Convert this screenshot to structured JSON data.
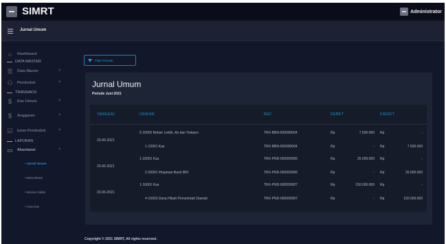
{
  "app": {
    "brand": "SIMRT",
    "user": "Administrator",
    "page_title": "Jurnal Umum"
  },
  "sidebar": {
    "items": [
      {
        "type": "link",
        "icon": "home-icon",
        "label": "Dashboard"
      },
      {
        "type": "section",
        "label": "DATA MASTER"
      },
      {
        "type": "link",
        "icon": "database-icon",
        "label": "Data Master",
        "chevron": ">"
      },
      {
        "type": "link",
        "icon": "people-icon",
        "label": "Penduduk",
        "chevron": ">"
      },
      {
        "type": "section",
        "label": "TRANSAKSI"
      },
      {
        "type": "link",
        "icon": "dollar-icon",
        "label": "Kas Umum",
        "chevron": ">"
      },
      {
        "type": "link",
        "icon": "dollar-icon",
        "label": "Anggaran",
        "chevron": ">"
      },
      {
        "type": "link",
        "icon": "checkbox-icon",
        "label": "Iuran Penduduk",
        "chevron": ">"
      },
      {
        "type": "section",
        "label": "LAPORAN"
      },
      {
        "type": "link",
        "icon": "monitor-icon",
        "label": "Akuntansi",
        "chevron": ">"
      }
    ],
    "subitems": [
      "Jurnal Umum",
      "Buku Besar",
      "Neraca Saldo",
      "Arus Kas"
    ]
  },
  "filter_button": "Filter Periode",
  "card": {
    "title": "Jurnal Umum",
    "period": "Periode Juni 2021"
  },
  "table": {
    "headers": [
      "TANGGAL",
      "URAIAN",
      "REF",
      "DEBET",
      "KREDIT"
    ],
    "groups": [
      {
        "date": "23-06-2021",
        "rows": [
          {
            "uraian": "5-10002 Beban Listrik, Air dan Telepon",
            "ref": "TRX-BBN-000000004",
            "debet_cur": "Rp",
            "debet": "7.500.000",
            "kredit_cur": "Rp",
            "kredit": "-"
          },
          {
            "uraian": "1-10001 Kas",
            "ref": "TRX-BBN-000000004",
            "debet_cur": "Rp",
            "debet": "-",
            "kredit_cur": "Rp",
            "kredit": "7.500.000"
          }
        ]
      },
      {
        "date": "23-06-2021",
        "rows": [
          {
            "uraian": "1-10001 Kas",
            "ref": "TRX-PND-000000006",
            "debet_cur": "Rp",
            "debet": "25.000.000",
            "kredit_cur": "Rp",
            "kredit": "-"
          },
          {
            "uraian": "2-20001 Pinjaman Bank BRI",
            "ref": "TRX-PND-000000006",
            "debet_cur": "Rp",
            "debet": "-",
            "kredit_cur": "Rp",
            "kredit": "25.000.000"
          }
        ]
      },
      {
        "date": "23-06-2021",
        "rows": [
          {
            "uraian": "1-10001 Kas",
            "ref": "TRX-PND-000000007",
            "debet_cur": "Rp",
            "debet": "150.000.000",
            "kredit_cur": "Rp",
            "kredit": "-"
          },
          {
            "uraian": "4-10003 Dana Hibah Pemerintah Daerah",
            "ref": "TRX-PND-000000007",
            "debet_cur": "Rp",
            "debet": "-",
            "kredit_cur": "Rp",
            "kredit": "150.000.000"
          }
        ]
      }
    ]
  },
  "footer": "Copyright © 2021 SIMRT, All rights reserved.",
  "colors": {
    "accent": "#1e9bd6",
    "background": "#13172a",
    "topbar": "#0a0d19",
    "card": "#1d2436"
  }
}
